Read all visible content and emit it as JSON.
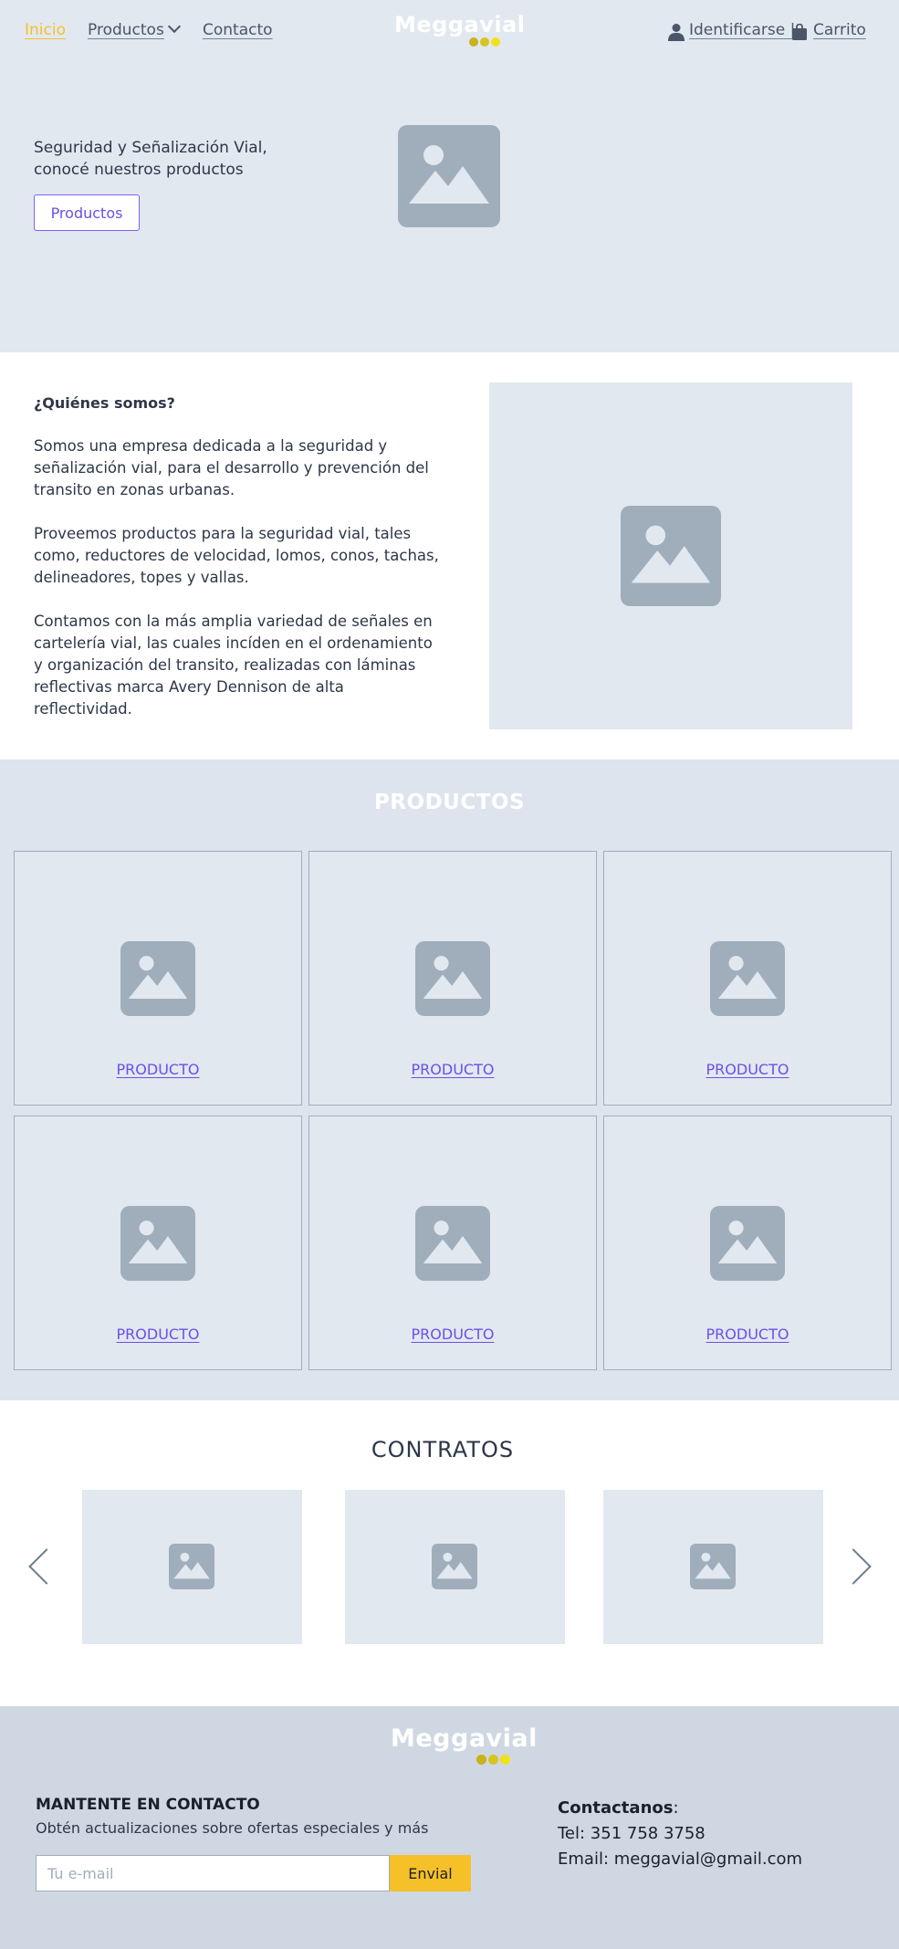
{
  "nav": {
    "home": "Inicio",
    "products": "Productos",
    "contact": "Contacto",
    "login": "Identificarse |",
    "cart": "Carrito",
    "logo": "Meggavial",
    "active_color": "#f6c028"
  },
  "hero": {
    "text": "Seguridad y Señalización Vial, conocé nuestros productos",
    "button": "Productos"
  },
  "about": {
    "title": "¿Quiénes somos?",
    "paragraphs": [
      "Somos una empresa dedicada a la seguridad y señalización vial, para el desarrollo y prevención del transito en zonas urbanas.",
      "Proveemos productos para la seguridad vial, tales como, reductores de velocidad, lomos, conos, tachas, delineadores, topes y vallas.",
      "Contamos con la más amplia variedad de señales en cartelería vial, las cuales incíden en el ordenamiento y organización del transito, realizadas con láminas reflectivas marca Avery Dennison de alta reflectividad."
    ]
  },
  "products": {
    "title": "PRODUCTOS",
    "items": [
      "PRODUCTO",
      "PRODUCTO",
      "PRODUCTO",
      "PRODUCTO",
      "PRODUCTO",
      "PRODUCTO"
    ]
  },
  "contracts": {
    "title": "CONTRATOS"
  },
  "footer": {
    "logo": "Meggavial",
    "newsletter_title": "MANTENTE EN CONTACTO",
    "newsletter_sub": "Obtén actualizaciones sobre ofertas especiales y más",
    "email_placeholder": "Tu e-mail",
    "submit": "Envial",
    "contact_title": "Contactanos",
    "phone": "Tel: 351 758 3758",
    "email": "Email: meggavial@gmail.com"
  },
  "colors": {
    "accent": "#f6c028",
    "link": "#6b50e6",
    "hero_bg": "#e2e8f0",
    "footer_bg": "#cfd8e2"
  }
}
